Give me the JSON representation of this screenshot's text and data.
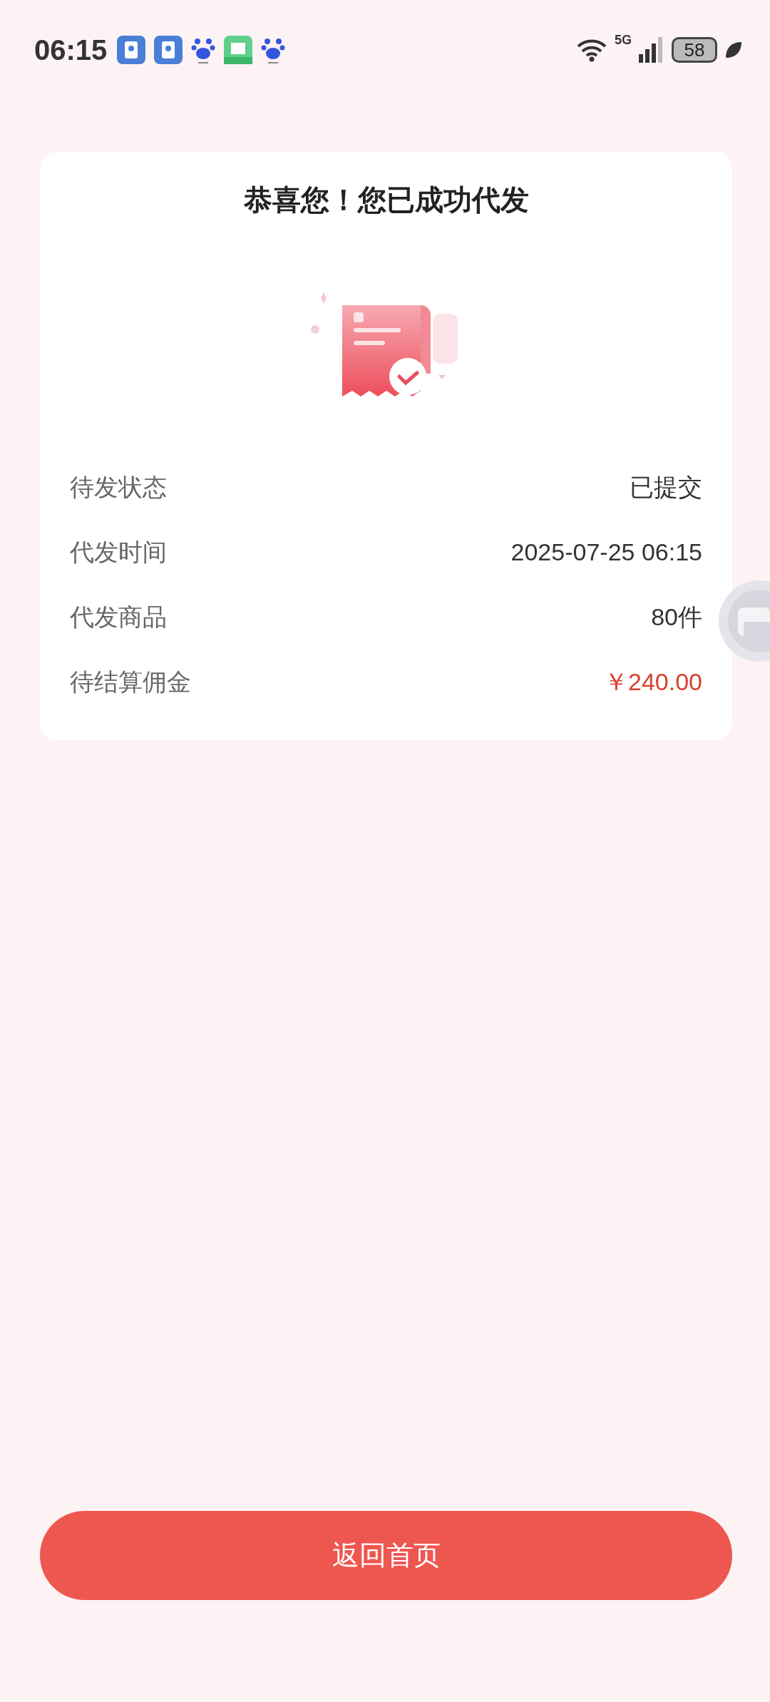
{
  "status_bar": {
    "time": "06:15",
    "network": "5G",
    "battery": "58"
  },
  "card": {
    "title": "恭喜您！您已成功代发",
    "rows": [
      {
        "label": "待发状态",
        "value": "已提交",
        "kind": "plain"
      },
      {
        "label": "代发时间",
        "value": "2025-07-25 06:15",
        "kind": "plain"
      },
      {
        "label": "代发商品",
        "value": "80件",
        "kind": "plain"
      },
      {
        "label": "待结算佣金",
        "value": "￥240.00",
        "kind": "price"
      }
    ]
  },
  "button": {
    "label": "返回首页"
  }
}
